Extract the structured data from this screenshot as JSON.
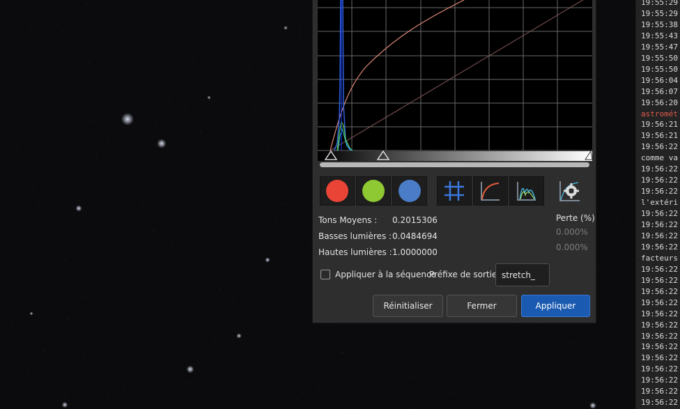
{
  "dialog": {
    "stats": [
      {
        "label": "Tons Moyens :",
        "value": "0.2015306"
      },
      {
        "label": "Basses lumières :",
        "value": "0.0484694"
      },
      {
        "label": "Hautes lumières :",
        "value": "1.0000000"
      }
    ],
    "perte": {
      "title": "Perte (%)",
      "values": [
        "0.000%",
        "0.000%"
      ]
    },
    "apply_sequence_label": "Appliquer à la séquence",
    "apply_sequence_checked": false,
    "output_prefix_label": "Préfixe de sortie :",
    "output_prefix_value": "stretch_",
    "buttons": {
      "reset": "Réinitialiser",
      "close": "Fermer",
      "apply": "Appliquer"
    },
    "channels": [
      {
        "name": "red",
        "color": "#ea4436"
      },
      {
        "name": "green",
        "color": "#8ec832"
      },
      {
        "name": "blue",
        "color": "#4a7cc8"
      }
    ],
    "tools": [
      "grid-icon",
      "curve-icon",
      "histogram-icon"
    ],
    "mtf_icon": "auto-stretch-icon"
  },
  "log": {
    "lines": [
      "19:55:29",
      "19:55:29",
      "19:55:38",
      "19:55:43",
      "19:55:47",
      "19:55:50",
      "19:55:50",
      "19:56:04",
      "19:56:07",
      "19:56:20",
      "astromét",
      "19:56:21",
      "19:56:21",
      "19:56:22",
      "comme va",
      "19:56:22",
      "19:56:22",
      "19:56:22",
      "l'extéri",
      "19:56:22",
      "19:56:22",
      "19:56:22",
      "19:56:22",
      "facteurs",
      "19:56:22",
      "19:56:22",
      "19:56:22",
      "19:56:22",
      "19:56:22",
      "19:56:22",
      "19:56:22",
      "19:56:22",
      "19:56:22",
      "19:56:22",
      "19:56:22",
      "19:56:22",
      "19:56:22"
    ],
    "error_line_index": 10
  },
  "colors": {
    "dialog_bg": "#2e2e2e",
    "accent": "#1a5ab0",
    "error_text": "#e05a4a"
  }
}
